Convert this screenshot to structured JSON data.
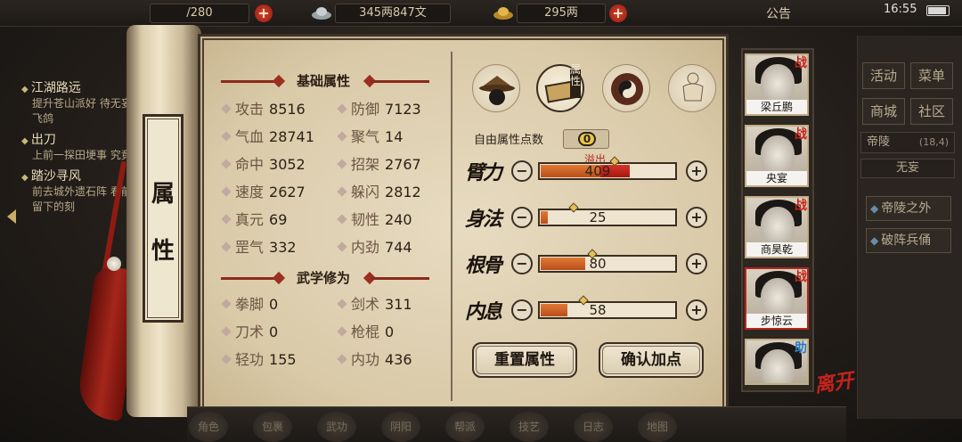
{
  "topbar": {
    "slot": "/280",
    "money": "345两847文",
    "gold": "295两",
    "notice": "公告",
    "time": "16:55"
  },
  "quests": [
    {
      "title": "江湖路远",
      "desc": "提升苍山派好 待无妄斋飞鸽"
    },
    {
      "title": "出刀",
      "desc": "上前一探田埂事 究竟"
    },
    {
      "title": "踏沙寻风",
      "desc": "前去城外遗石阵 看前人留下的刻"
    }
  ],
  "scroll_tab": {
    "char1": "属",
    "char2": "性"
  },
  "basic": {
    "title": "基础属性",
    "stats": [
      {
        "name": "攻击",
        "value": "8516"
      },
      {
        "name": "防御",
        "value": "7123"
      },
      {
        "name": "气血",
        "value": "28741"
      },
      {
        "name": "聚气",
        "value": "14"
      },
      {
        "name": "命中",
        "value": "3052"
      },
      {
        "name": "招架",
        "value": "2767"
      },
      {
        "name": "速度",
        "value": "2627"
      },
      {
        "name": "躲闪",
        "value": "2812"
      },
      {
        "name": "真元",
        "value": "69"
      },
      {
        "name": "韧性",
        "value": "240"
      },
      {
        "name": "罡气",
        "value": "332"
      },
      {
        "name": "内劲",
        "value": "744"
      }
    ]
  },
  "martial": {
    "title": "武学修为",
    "stats": [
      {
        "name": "拳脚",
        "value": "0"
      },
      {
        "name": "剑术",
        "value": "311"
      },
      {
        "name": "刀术",
        "value": "0"
      },
      {
        "name": "枪棍",
        "value": "0"
      },
      {
        "name": "轻功",
        "value": "155"
      },
      {
        "name": "内功",
        "value": "436"
      }
    ]
  },
  "category_icons": [
    "straw-hat-icon",
    "attribute-book-icon",
    "taiji-icon",
    "body-figure-icon"
  ],
  "category_tag": "属性",
  "free_points": {
    "label": "自由属性点数",
    "value": "0"
  },
  "overflow_label": "溢出",
  "attributes": [
    {
      "name": "臂力",
      "value": "409",
      "fill": 0.44,
      "overflow": 0.22
    },
    {
      "name": "身法",
      "value": "25",
      "fill": 0.05,
      "overflow": 0
    },
    {
      "name": "根骨",
      "value": "80",
      "fill": 0.33,
      "overflow": 0
    },
    {
      "name": "内息",
      "value": "58",
      "fill": 0.2,
      "overflow": 0
    }
  ],
  "buttons": {
    "reset": "重置属性",
    "confirm": "确认加点",
    "minus": "−",
    "plus": "+"
  },
  "party": [
    {
      "name": "梁丘鹏",
      "tag": "战"
    },
    {
      "name": "央宴",
      "tag": "战"
    },
    {
      "name": "商昊乾",
      "tag": "战"
    },
    {
      "name": "步惊云",
      "tag": "战"
    },
    {
      "name": "",
      "tag": "助"
    }
  ],
  "leave_label": "离开",
  "menu": {
    "items": [
      "活动",
      "菜单",
      "商城",
      "社区"
    ],
    "region": "帝陵",
    "region_coord": "(18,4)",
    "region2": "无妄",
    "locations": [
      "帝陵之外",
      "破阵兵俑"
    ]
  },
  "dock": [
    "角色",
    "包裹",
    "武功",
    "阴阳",
    "帮派",
    "技艺",
    "日志",
    "地图"
  ],
  "colors": {
    "accent": "#b5261a",
    "overflow": "#d8342a",
    "bar": "#c85c24"
  }
}
